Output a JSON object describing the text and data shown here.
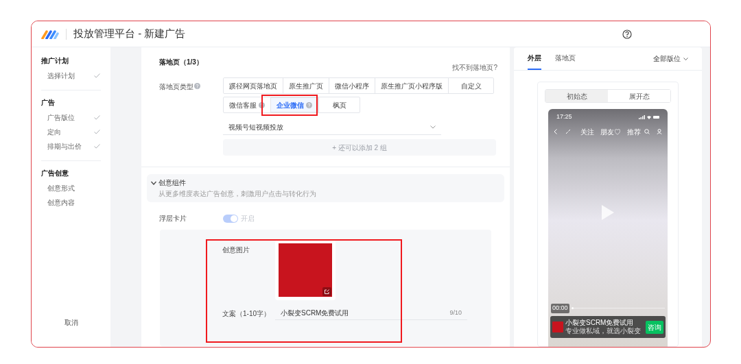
{
  "header": {
    "title": "投放管理平台 - 新建广告"
  },
  "sidebar": {
    "groups": [
      {
        "title": "推广计划",
        "items": [
          {
            "label": "选择计划",
            "done": true
          }
        ]
      },
      {
        "title": "广告",
        "items": [
          {
            "label": "广告版位",
            "done": true
          },
          {
            "label": "定向",
            "done": true
          },
          {
            "label": "排期与出价",
            "done": true
          }
        ]
      },
      {
        "title": "广告创意",
        "items": [
          {
            "label": "创意形式",
            "done": false
          },
          {
            "label": "创意内容",
            "done": false
          }
        ]
      }
    ],
    "cancel": "取消"
  },
  "landing": {
    "title": "落地页（1/3）",
    "help_link": "找不到落地页?",
    "type_label": "落地页类型",
    "option_rows": [
      [
        {
          "label": "蹊径网页落地页",
          "selected": false,
          "help": false
        },
        {
          "label": "原生推广页",
          "selected": false,
          "help": false
        },
        {
          "label": "微信小程序",
          "selected": false,
          "help": false
        },
        {
          "label": "原生推广页小程序版",
          "selected": false,
          "help": false
        },
        {
          "label": "自定义",
          "selected": false,
          "help": false
        }
      ],
      [
        {
          "label": "微信客服",
          "selected": false,
          "help": true
        },
        {
          "label": "企业微信",
          "selected": true,
          "help": true
        },
        {
          "label": "枫页",
          "selected": false,
          "help": false
        }
      ]
    ],
    "select_value": "视频号短视频投放",
    "add_button": {
      "label": "+ 还可以添加 2 组",
      "disabled": true
    }
  },
  "creative": {
    "title": "创意组件",
    "description": "从更多维度表达广告创意，刺激用户点击与转化行为",
    "expanded": true,
    "float_card": {
      "label": "浮层卡片",
      "on": true,
      "state_text": "开启"
    },
    "image_label": "创意图片",
    "copy_label": "文案（1-10字）",
    "copy_value": "小裂变SCRM免费试用",
    "copy_count": "9/10"
  },
  "preview": {
    "tabs": [
      {
        "label": "外层",
        "selected": true
      },
      {
        "label": "落地页",
        "selected": false
      }
    ],
    "placement": "全部版位",
    "states": [
      {
        "label": "初始态",
        "selected": true
      },
      {
        "label": "展开态",
        "selected": false
      }
    ],
    "phone": {
      "time": "17:25",
      "nav": [
        "关注",
        "朋友♡",
        "推荐"
      ],
      "progress_time": "00:00",
      "ad": {
        "title": "小裂变SCRM免费试用",
        "subtitle": "专业做私域，就选小裂变",
        "button": "咨询"
      }
    }
  }
}
